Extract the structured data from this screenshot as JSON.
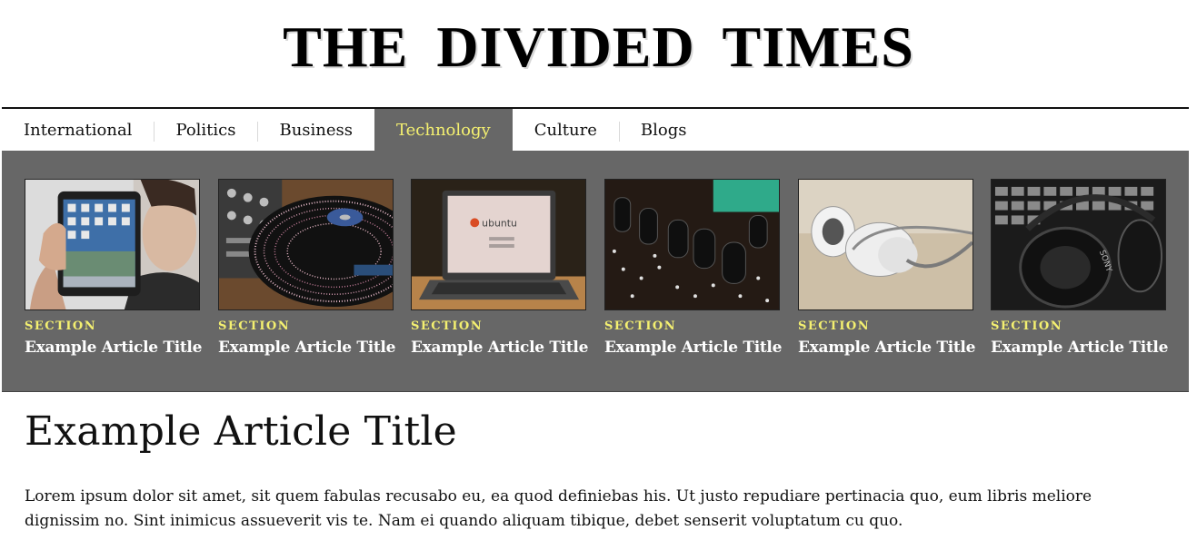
{
  "masthead": {
    "title": "THE DIVIDED TIMES"
  },
  "nav": {
    "items": [
      {
        "label": "International",
        "active": false
      },
      {
        "label": "Politics",
        "active": false
      },
      {
        "label": "Business",
        "active": false
      },
      {
        "label": "Technology",
        "active": true
      },
      {
        "label": "Culture",
        "active": false
      },
      {
        "label": "Blogs",
        "active": false
      }
    ]
  },
  "colors": {
    "panel": "#676767",
    "accent": "#f4f070",
    "text": "#111111"
  },
  "dropdown": {
    "cards": [
      {
        "image": "tablet-photo",
        "section": "SECTION",
        "title": "Example Article Title"
      },
      {
        "image": "turntable-photo",
        "section": "SECTION",
        "title": "Example Article Title"
      },
      {
        "image": "ubuntu-laptop-photo",
        "section": "SECTION",
        "title": "Example Article Title"
      },
      {
        "image": "circuit-board-photo",
        "section": "SECTION",
        "title": "Example Article Title"
      },
      {
        "image": "earphones-photo",
        "section": "SECTION",
        "title": "Example Article Title"
      },
      {
        "image": "headphones-keyboard-photo",
        "section": "SECTION",
        "title": "Example Article Title"
      }
    ],
    "laptop_screen_text": "ubuntu",
    "headphone_brand": "SONY"
  },
  "article": {
    "title": "Example Article Title",
    "body": "Lorem ipsum dolor sit amet, sit quem fabulas recusabo eu, ea quod definiebas his. Ut justo repudiare pertinacia quo, eum libris meliore dignissim no. Sint inimicus assueverit vis te. Nam ei quando aliquam tibique, debet senserit voluptatum cu quo."
  }
}
